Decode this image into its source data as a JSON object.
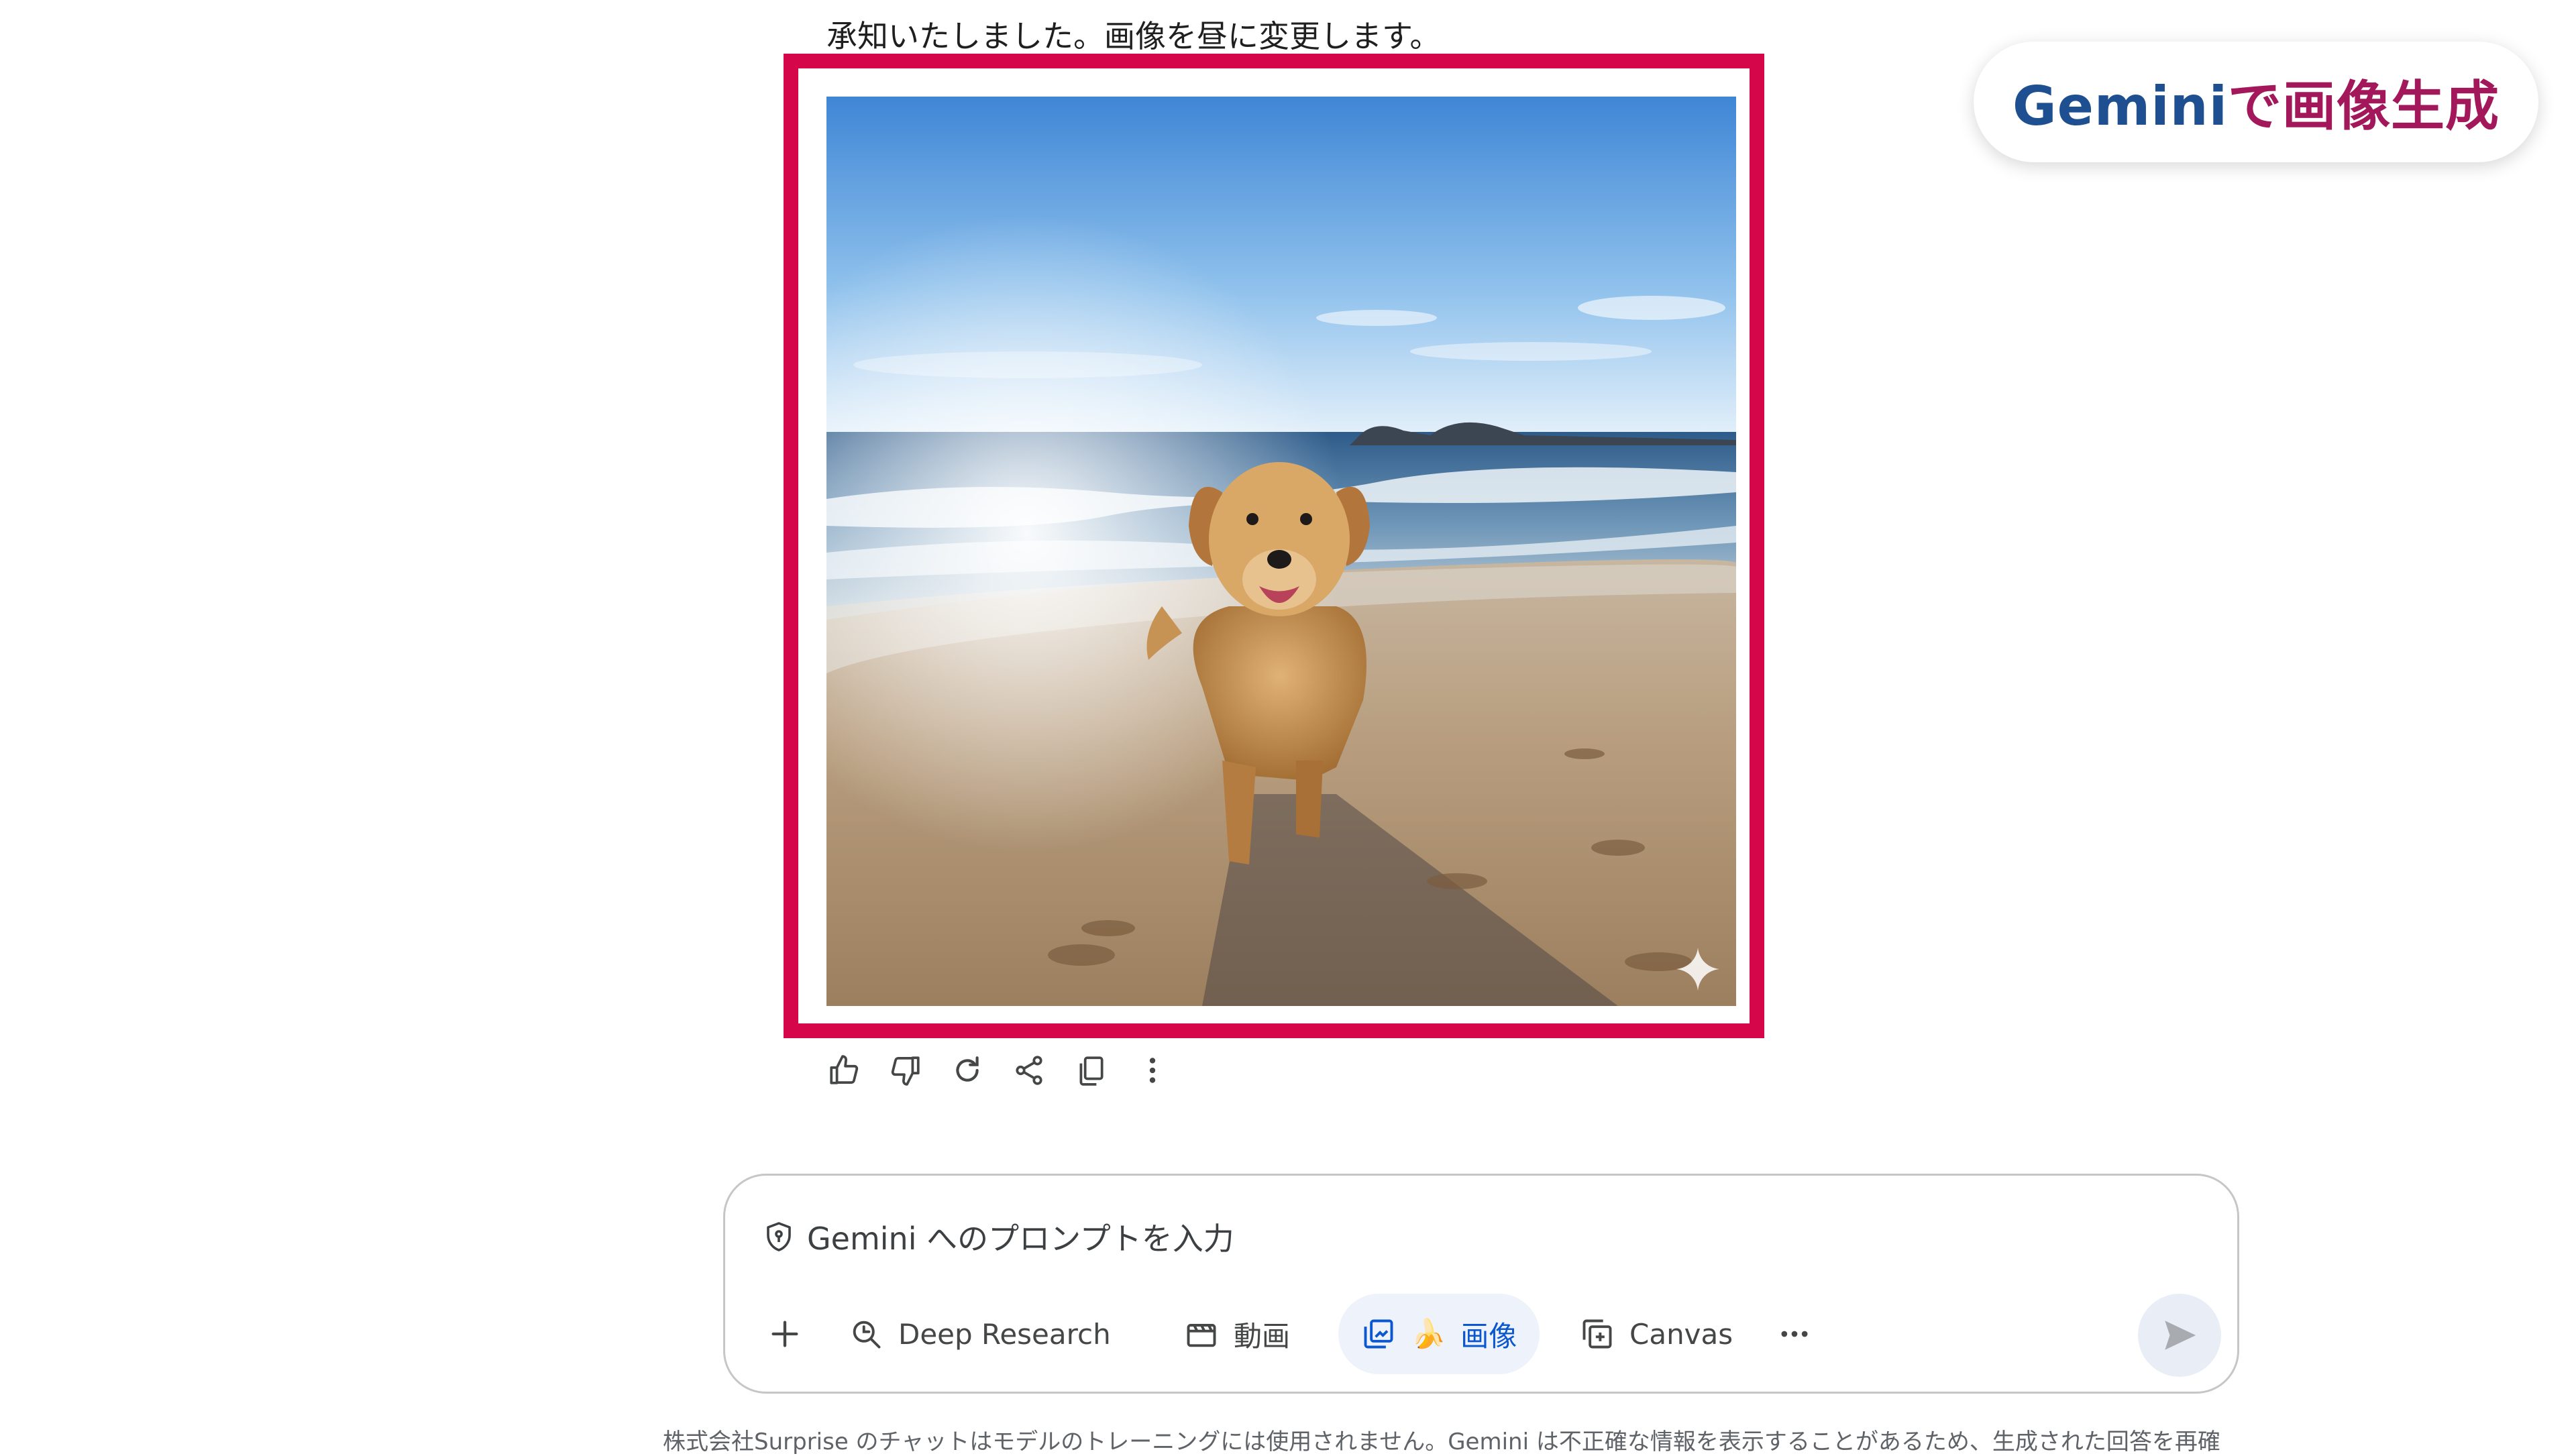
{
  "response": {
    "text": "承知いたしました。画像を昼に変更します。"
  },
  "badge": {
    "part1": "Gemini",
    "part2": "で画像生成"
  },
  "image": {
    "alt": "ビーチを走るゴールデンレトリバー",
    "watermark_icon": "gemini-sparkle-icon"
  },
  "actions": [
    {
      "icon": "thumb-up-icon"
    },
    {
      "icon": "thumb-down-icon"
    },
    {
      "icon": "regenerate-icon"
    },
    {
      "icon": "share-icon"
    },
    {
      "icon": "copy-icon"
    },
    {
      "icon": "more-vert-icon"
    }
  ],
  "composer": {
    "placeholder": "Gemini へのプロンプトを入力",
    "tools": {
      "deep_research": "Deep Research",
      "video": "動画",
      "image_emoji": "🍌",
      "image": "画像",
      "canvas": "Canvas"
    }
  },
  "disclaimer": "株式会社Surprise のチャットはモデルのトレーニングには使用されません。Gemini は不正確な情報を表示することがあるため、生成された回答を再確",
  "colors": {
    "highlight": "#d6064a",
    "badge_blue": "#1d4f91",
    "badge_magenta": "#a2185b",
    "active_tool_bg": "#eef2fb",
    "active_tool_text": "#0b57d0"
  }
}
